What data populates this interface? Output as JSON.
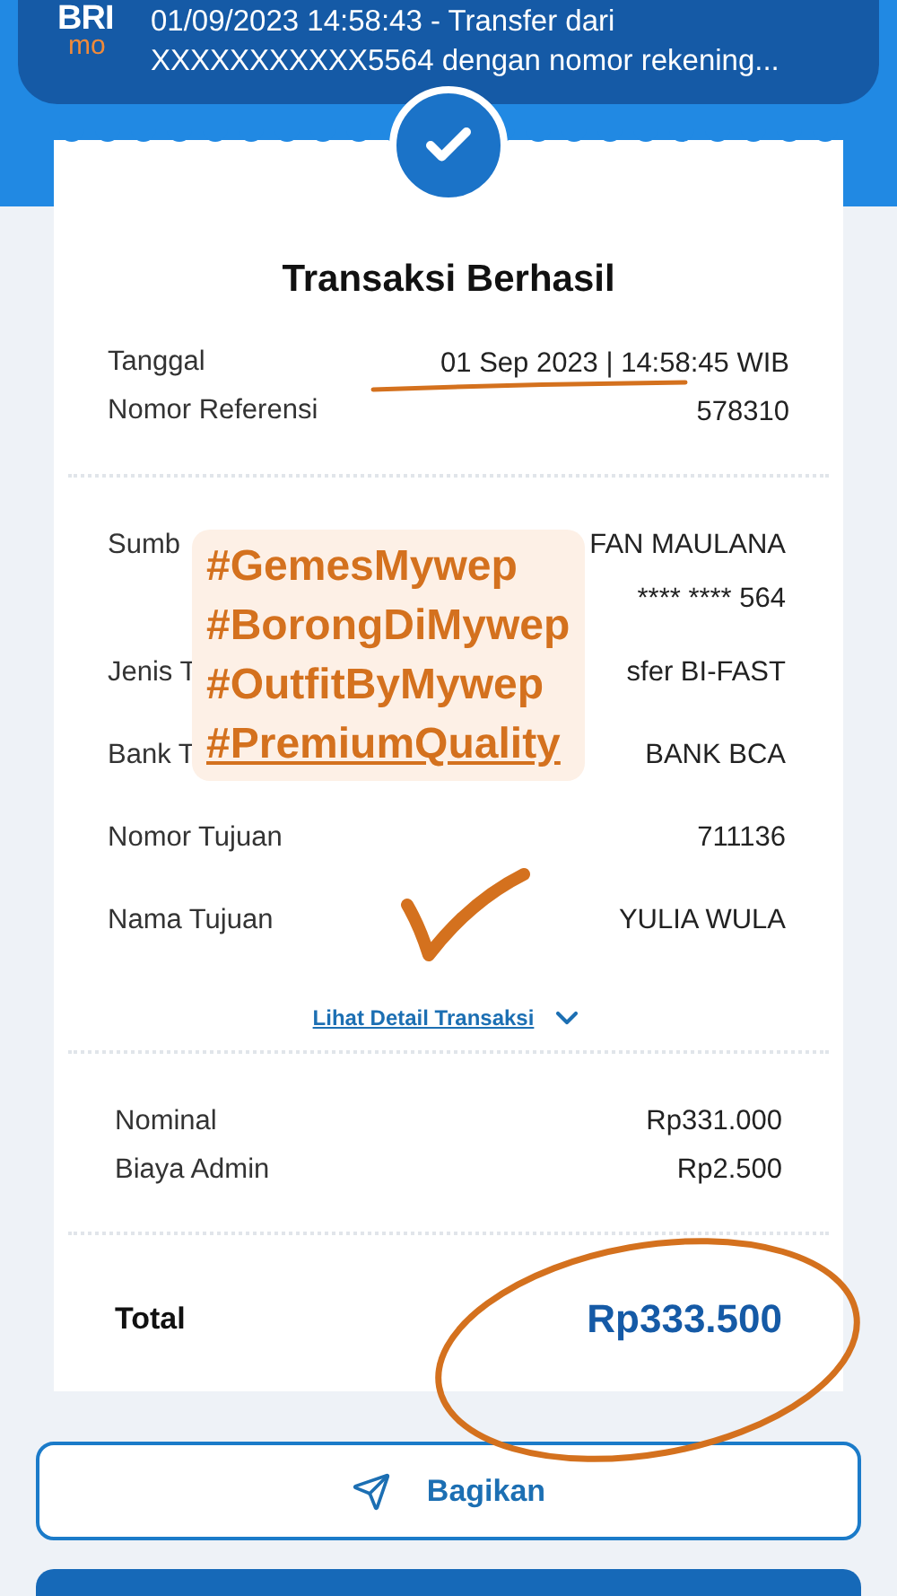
{
  "notification": {
    "logo_top": "BRI",
    "logo_bottom": "mo",
    "lines": [
      "01/09/2023 14:58:43 - Transfer dari",
      "XXXXXXXXXXX5564 dengan nomor rekening..."
    ]
  },
  "receipt": {
    "title": "Transaksi Berhasil",
    "header_rows": [
      {
        "label": "Tanggal",
        "value": "01 Sep 2023 | 14:58:45 WIB"
      },
      {
        "label": "Nomor Referensi",
        "value": "578310"
      }
    ],
    "detail_rows": [
      {
        "label": "Sumb",
        "values": [
          "FAN MAULANA",
          "**** **** 564"
        ]
      },
      {
        "label": "Jenis T",
        "values": [
          "sfer BI-FAST"
        ]
      },
      {
        "label": "Bank T",
        "values": [
          "BANK BCA"
        ]
      },
      {
        "label": "Nomor Tujuan",
        "values": [
          "711136"
        ]
      },
      {
        "label": "Nama Tujuan",
        "values": [
          "YULIA WULA"
        ]
      }
    ],
    "detail_link": "Lihat Detail Transaksi",
    "amount_rows": [
      {
        "label": "Nominal",
        "value": "Rp331.000"
      },
      {
        "label": "Biaya Admin",
        "value": "Rp2.500"
      }
    ],
    "total": {
      "label": "Total",
      "value": "Rp333.500"
    }
  },
  "sticker": {
    "lines": [
      {
        "text": "#GemesMywep",
        "underlined": false
      },
      {
        "text": "#BorongDiMywep",
        "underlined": false
      },
      {
        "text": "#OutfitByMywep",
        "underlined": false
      },
      {
        "text": "#PremiumQuality",
        "underlined": true
      }
    ]
  },
  "share_button": "Bagikan"
}
